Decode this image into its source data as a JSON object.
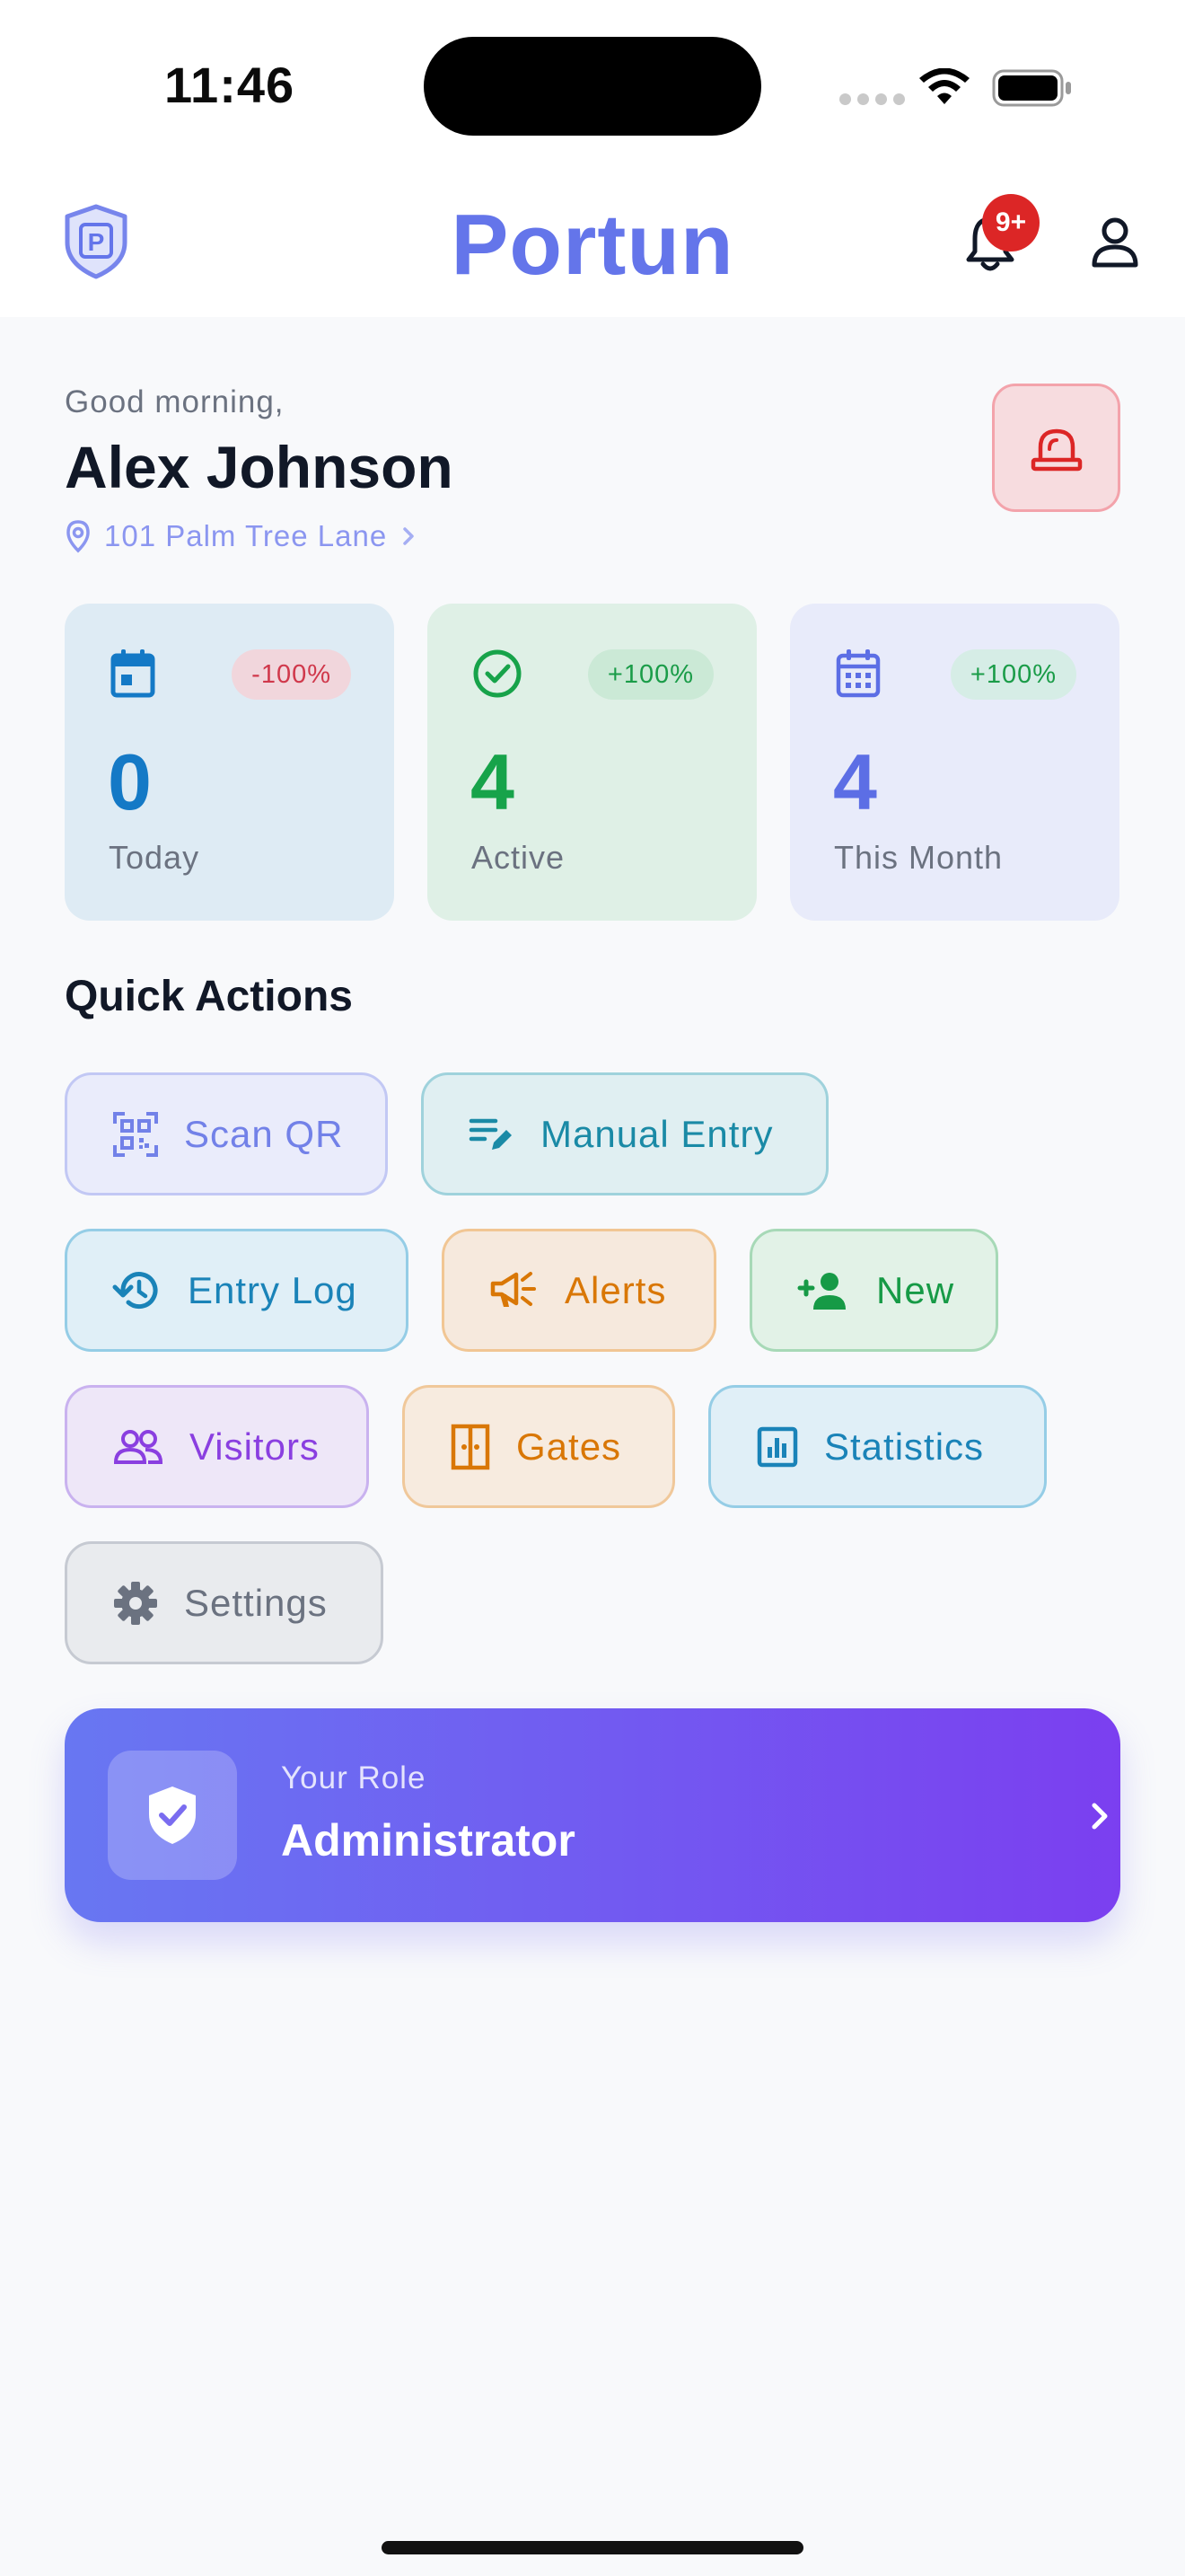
{
  "status_bar": {
    "time": "11:46"
  },
  "header": {
    "brand": "Portun",
    "notification_badge": "9+",
    "accent": "#6475ea"
  },
  "greeting": {
    "salutation": "Good morning,",
    "name": "Alex Johnson",
    "address": "101 Palm Tree Lane"
  },
  "stats": [
    {
      "icon": "calendar-today-icon",
      "change": "-100%",
      "value": "0",
      "label": "Today"
    },
    {
      "icon": "check-circle-icon",
      "change": "+100%",
      "value": "4",
      "label": "Active"
    },
    {
      "icon": "calendar-month-icon",
      "change": "+100%",
      "value": "4",
      "label": "This Month"
    }
  ],
  "quick_actions": {
    "title": "Quick Actions",
    "items": [
      {
        "label": "Scan QR",
        "icon": "qr-code-icon"
      },
      {
        "label": "Manual Entry",
        "icon": "edit-note-icon"
      },
      {
        "label": "Entry Log",
        "icon": "history-icon"
      },
      {
        "label": "Alerts",
        "icon": "megaphone-icon"
      },
      {
        "label": "New",
        "icon": "person-add-icon"
      },
      {
        "label": "Visitors",
        "icon": "people-icon"
      },
      {
        "label": "Gates",
        "icon": "door-icon"
      },
      {
        "label": "Statistics",
        "icon": "chart-icon"
      },
      {
        "label": "Settings",
        "icon": "gear-icon"
      }
    ]
  },
  "role": {
    "caption": "Your Role",
    "value": "Administrator"
  }
}
